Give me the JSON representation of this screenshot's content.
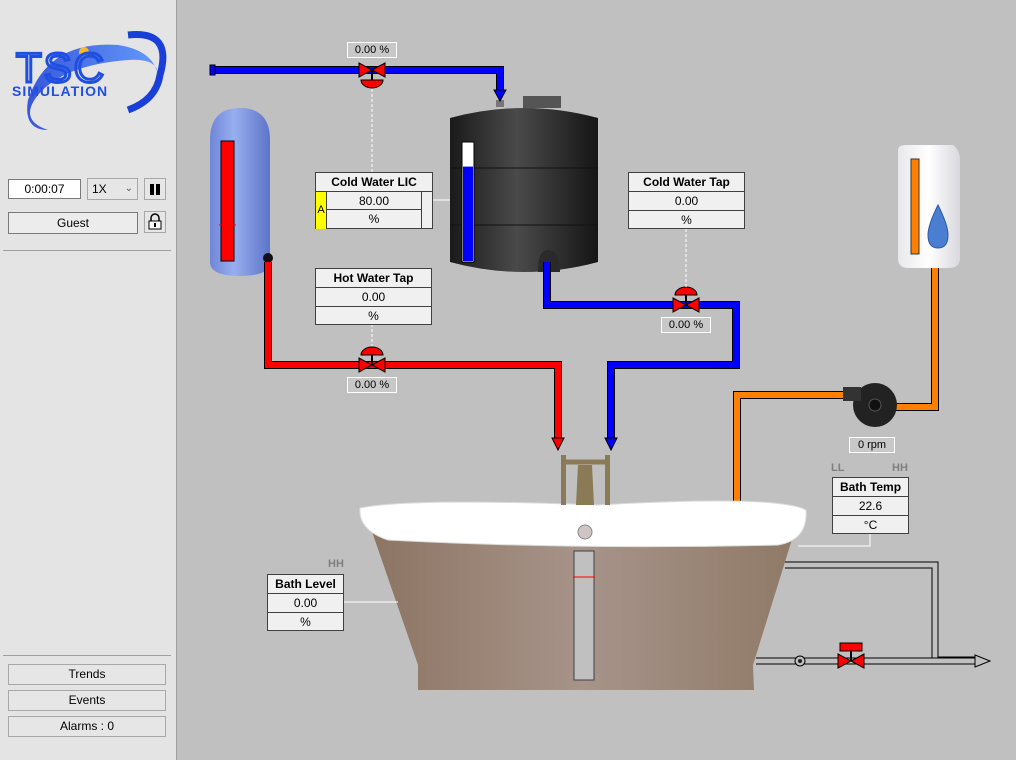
{
  "sidebar": {
    "logo": {
      "line1": "TSC",
      "line2": "SIMULATION"
    },
    "clock": "0:00:07",
    "speed": {
      "selected": "1X"
    },
    "pause_icon": "pause-icon",
    "user": "Guest",
    "lock_icon": "lock-icon",
    "buttons": {
      "trends": "Trends",
      "events": "Events",
      "alarms": "Alarms : 0"
    }
  },
  "process": {
    "colors": {
      "cold": "#0000ff",
      "hot": "#ff0000",
      "soap": "#ff8000",
      "drain": "#c0c0c0",
      "valve": "#ff0000"
    },
    "inlet_valve": {
      "value": "0.00 %"
    },
    "cold_water_lic": {
      "title": "Cold Water LIC",
      "mode": "A",
      "value": "80.00",
      "unit": "%",
      "level_fraction": 0.8
    },
    "cold_water_tap": {
      "title": "Cold Water Tap",
      "value": "0.00",
      "unit": "%",
      "valve_value": "0.00 %"
    },
    "hot_water_tap": {
      "title": "Hot Water Tap",
      "value": "0.00",
      "unit": "%",
      "valve_value": "0.00 %"
    },
    "hot_tank": {
      "level_fraction": 1.0
    },
    "soap_dispenser": {
      "level_fraction": 1.0
    },
    "pump": {
      "value": "0 rpm"
    },
    "bath_temp": {
      "title": "Bath Temp",
      "value": "22.6",
      "unit": "°C",
      "alarm_low": "LL",
      "alarm_high": "HH"
    },
    "bath_level": {
      "title": "Bath Level",
      "value": "0.00",
      "unit": "%",
      "alarm_high": "HH",
      "level_fraction": 0.0
    }
  }
}
